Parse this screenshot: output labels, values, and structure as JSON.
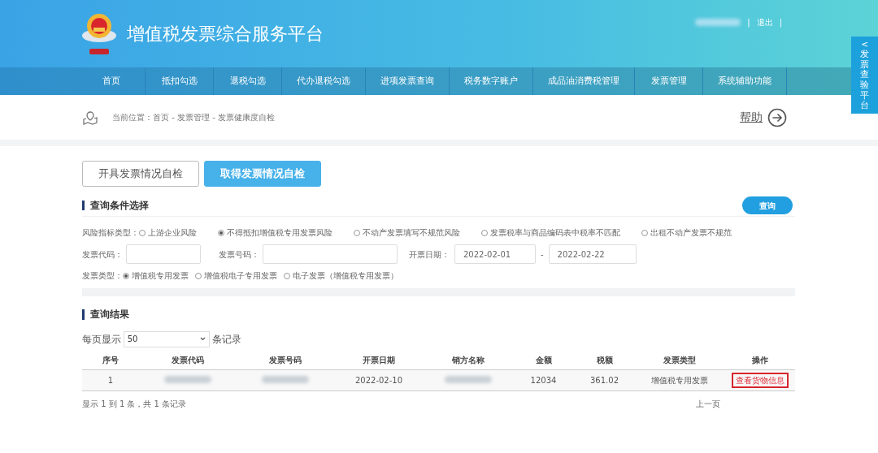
{
  "header": {
    "title": "增值税发票综合服务平台",
    "user_links": [
      {
        "kind": "redacted"
      },
      {
        "kind": "separator",
        "text": "|"
      },
      {
        "kind": "link",
        "text": "退出"
      },
      {
        "kind": "separator",
        "text": "|"
      }
    ]
  },
  "side_tab": {
    "arrow": "<",
    "text": "发票查验平台"
  },
  "nav": [
    "首页",
    "抵扣勾选",
    "退税勾选",
    "代办退税勾选",
    "进项发票查询",
    "税务数字账户",
    "成品油消费税管理",
    "发票管理",
    "系统辅助功能"
  ],
  "breadcrumb": {
    "label": "当前位置：",
    "items": [
      "首页",
      "发票管理",
      "发票健康度自检"
    ],
    "separator": "-",
    "help": "帮助"
  },
  "mode_tabs": [
    {
      "label": "开具发票情况自检",
      "selected": false
    },
    {
      "label": "取得发票情况自检",
      "selected": true
    }
  ],
  "conditions": {
    "title": "查询条件选择",
    "query_button": "查询",
    "risk": {
      "label": "风险指标类型：",
      "options": [
        {
          "label": "上游企业风险",
          "selected": false
        },
        {
          "label": "不得抵扣增值税专用发票风险",
          "selected": true
        },
        {
          "label": "不动产发票填写不规范风险",
          "selected": false
        },
        {
          "label": "发票税率与商品编码表中税率不匹配",
          "selected": false
        },
        {
          "label": "出租不动产发票不规范",
          "selected": false
        }
      ]
    },
    "invoice_code": {
      "label": "发票代码："
    },
    "invoice_number": {
      "label": "发票号码："
    },
    "date": {
      "label": "开票日期：",
      "from": "2022-02-01",
      "separator": "-",
      "to": "2022-02-22"
    },
    "invoice_type": {
      "label": "发票类型：",
      "options": [
        {
          "label": "增值税专用发票",
          "selected": true
        },
        {
          "label": "增值税电子专用发票",
          "selected": false
        },
        {
          "label": "电子发票（增值税专用发票）",
          "selected": false
        }
      ]
    }
  },
  "results": {
    "title": "查询结果",
    "page_size": {
      "before": "每页显示",
      "value": "50",
      "after": "条记录"
    },
    "table": {
      "columns": [
        "序号",
        "发票代码",
        "发票号码",
        "开票日期",
        "销方名称",
        "金额",
        "税额",
        "发票类型",
        "操作"
      ],
      "rows": [
        [
          {
            "kind": "text",
            "text": "1"
          },
          {
            "kind": "redacted"
          },
          {
            "kind": "redacted"
          },
          {
            "kind": "text",
            "text": "2022-02-10"
          },
          {
            "kind": "redacted"
          },
          {
            "kind": "text",
            "text": "12034"
          },
          {
            "kind": "text",
            "text": "361.02"
          },
          {
            "kind": "text",
            "text": "增值税专用发票"
          },
          {
            "kind": "link",
            "text": "查看货物信息"
          }
        ]
      ]
    },
    "summary": "显示 1 到 1 条，共 1 条记录",
    "prev_page": "上一页"
  }
}
